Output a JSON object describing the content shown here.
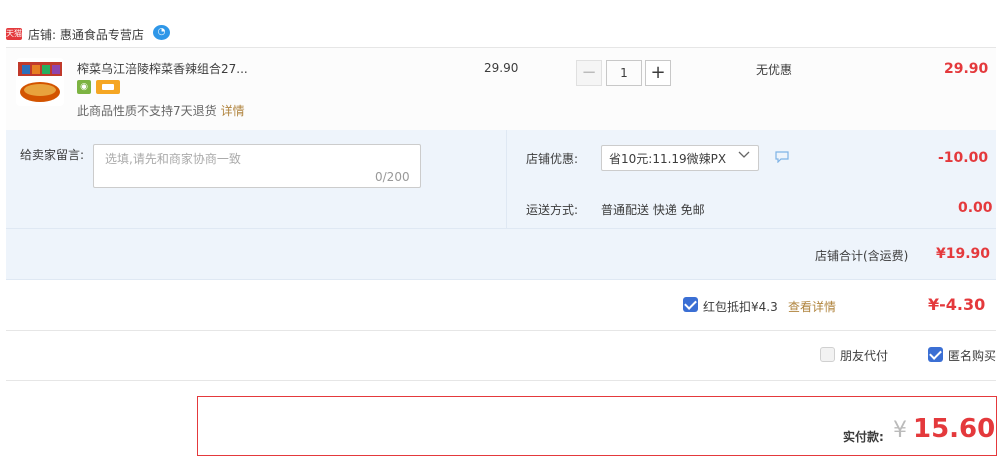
{
  "shop": {
    "badge": "天猫",
    "label": "店铺: 惠通食品专营店"
  },
  "item": {
    "title": "榨菜乌江涪陵榨菜香辣组合27...",
    "no_return_text": "此商品性质不支持7天退货",
    "detail_link": "详情",
    "unit_price": "29.90",
    "quantity": "1",
    "discount_text": "无优惠",
    "total": "29.90"
  },
  "message": {
    "label": "给卖家留言:",
    "placeholder": "选填,请先和商家协商一致",
    "count": "0/200"
  },
  "shop_discount": {
    "label": "店铺优惠:",
    "selected": "省10元:11.19微辣PX",
    "amount": "-10.00"
  },
  "shipping": {
    "label": "运送方式:",
    "method": "普通配送 快递 免邮",
    "fee": "0.00"
  },
  "shop_total": {
    "label": "店铺合计(含运费)",
    "amount": "¥19.90"
  },
  "red_packet": {
    "label": "红包抵扣¥4.3",
    "link": "查看详情",
    "amount": "¥-4.30",
    "checked": true
  },
  "options": {
    "friend_pay": "朋友代付",
    "anonymous": "匿名购买"
  },
  "payment": {
    "label": "实付款:",
    "currency": "¥",
    "amount": "15.60"
  },
  "colors": {
    "accent_red": "#e4393c",
    "link_brown": "#b0843e",
    "checkbox_blue": "#3b6fd4",
    "info_bg": "#eef4fb"
  }
}
